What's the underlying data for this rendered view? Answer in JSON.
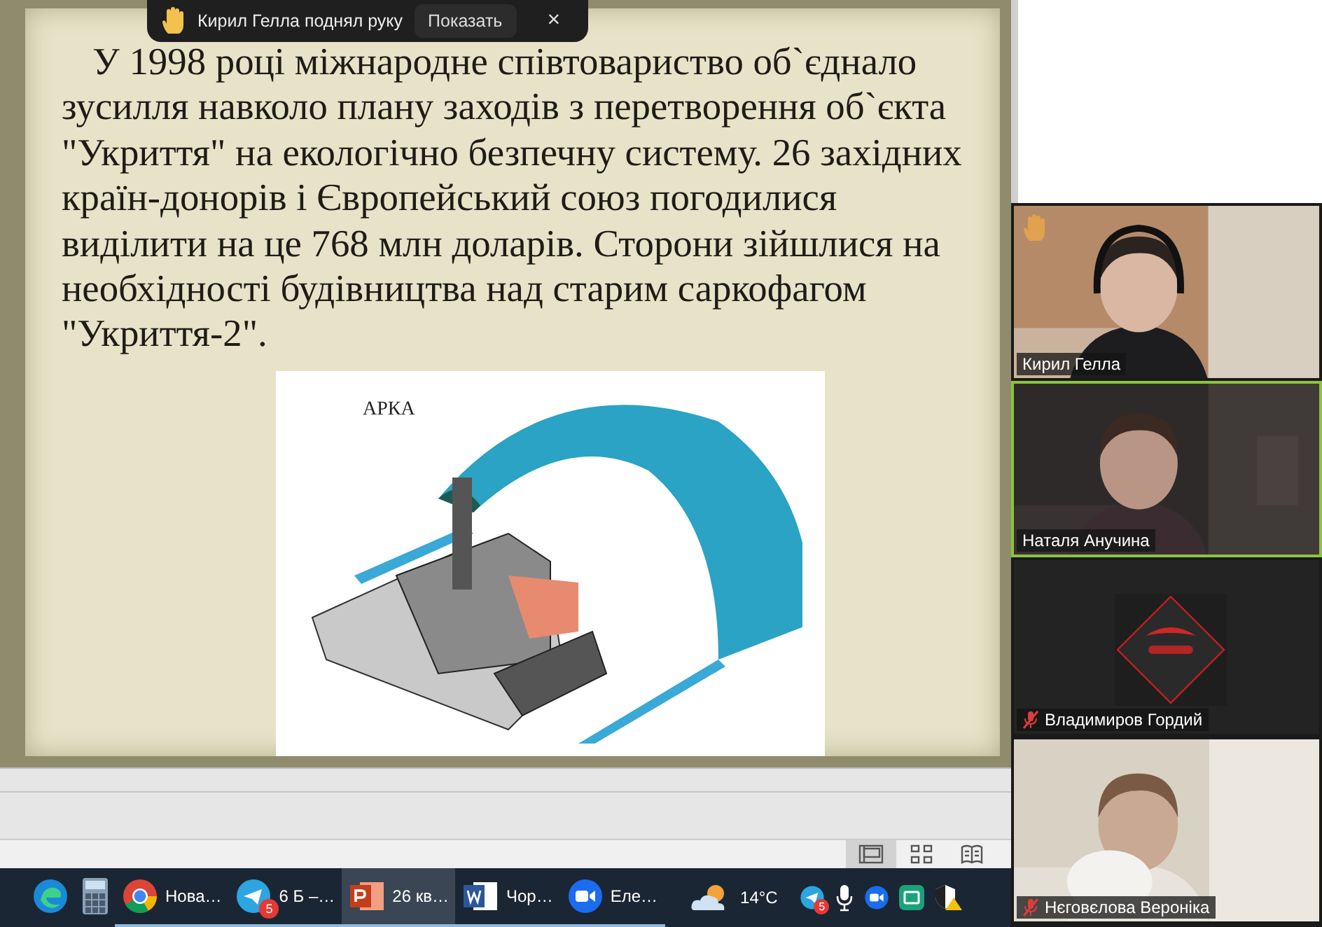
{
  "notification": {
    "text": "Кирил Гелла поднял руку",
    "button": "Показать",
    "close": "×"
  },
  "slide": {
    "paragraph": "У 1998 році міжнародне співтовариство об`єднало зусилля навколо плану заходів з перетворення об`єкта \"Укриття\" на екологічно безпечну систему. 26 західних країн-донорів і Європейський союз погодилися виділити на це 768 млн доларів. Сторони зійшлися на необхідності будівництва над старим саркофагом \"Укриття-2\".",
    "figure_label": "АРКА"
  },
  "view_buttons": [
    {
      "kind": "normal",
      "selected": true
    },
    {
      "kind": "sorter",
      "selected": false
    },
    {
      "kind": "reading",
      "selected": false
    }
  ],
  "taskbar": {
    "items": [
      {
        "kind": "edge",
        "running": false,
        "selected": false
      },
      {
        "kind": "calculator",
        "running": false,
        "selected": false
      },
      {
        "kind": "chrome",
        "label": "Нова…",
        "running": true,
        "selected": false
      },
      {
        "kind": "telegram",
        "label": "6 Б –…",
        "badge": "5",
        "running": true,
        "selected": false
      },
      {
        "kind": "powerpoint",
        "label": "26 кв…",
        "running": true,
        "selected": true
      },
      {
        "kind": "word",
        "label": "Чор…",
        "running": true,
        "selected": false
      },
      {
        "kind": "zoom",
        "label": "Еле…",
        "running": true,
        "selected": false
      }
    ],
    "weather": "14°C",
    "tray": [
      {
        "kind": "telegram",
        "badge": "5"
      },
      {
        "kind": "mic"
      },
      {
        "kind": "zoom"
      },
      {
        "kind": "green"
      },
      {
        "kind": "shield"
      }
    ]
  },
  "participants": [
    {
      "name": "Кирил Гелла",
      "kind": "video",
      "hand_raised": true,
      "muted": false,
      "active": false
    },
    {
      "name": "Наталя Анучина",
      "kind": "video",
      "hand_raised": false,
      "muted": false,
      "active": true
    },
    {
      "name": "Владимиров Гордий",
      "kind": "avatar",
      "hand_raised": false,
      "muted": true,
      "active": false
    },
    {
      "name": "Нєговєлова Вероніка",
      "kind": "video",
      "hand_raised": false,
      "muted": true,
      "active": false
    }
  ]
}
